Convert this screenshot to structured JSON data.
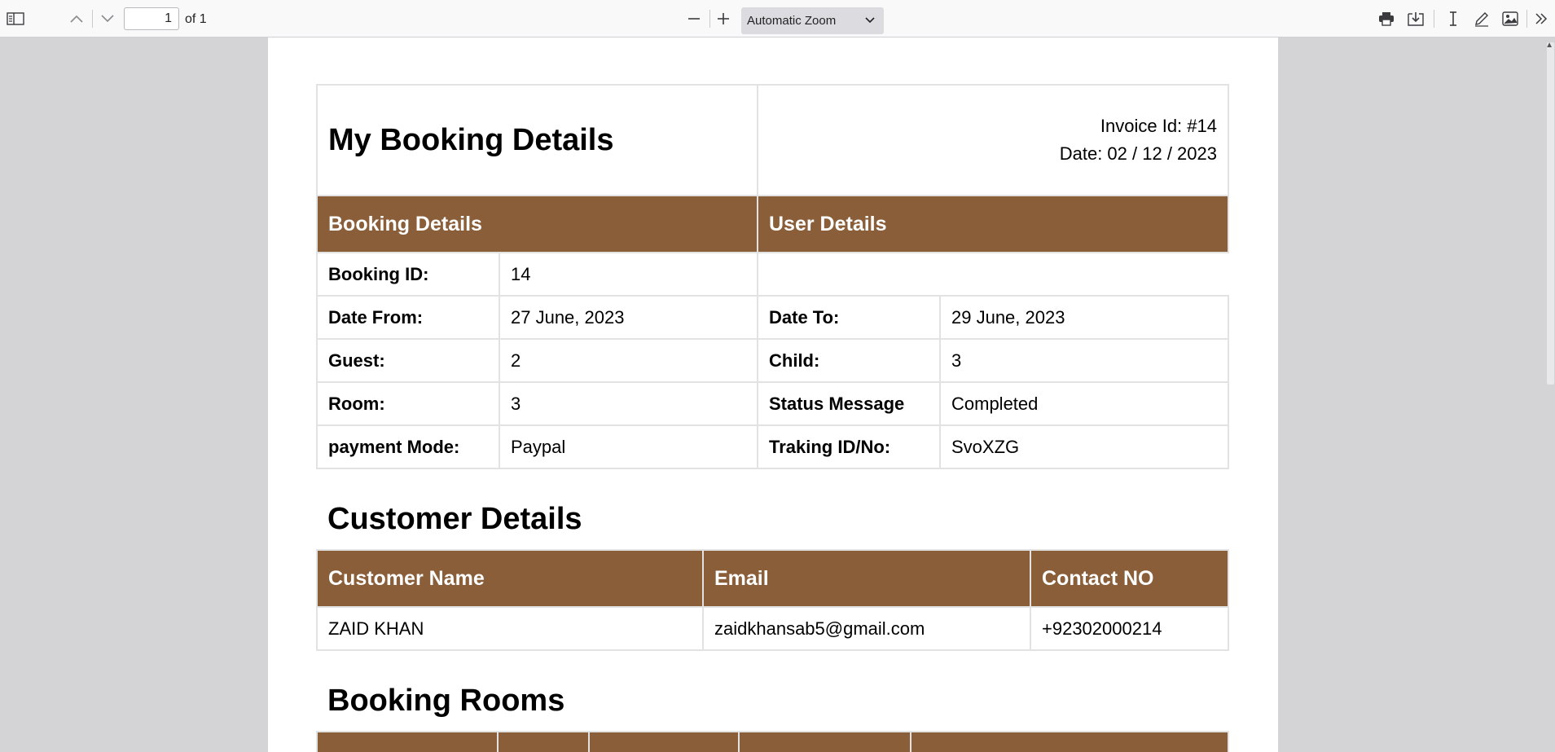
{
  "toolbar": {
    "page_number": "1",
    "page_count_label": "of 1",
    "zoom_label": "Automatic Zoom"
  },
  "doc": {
    "title": "My Booking Details",
    "invoice_id": "Invoice Id: #14",
    "invoice_date": "Date: 02 / 12 / 2023",
    "booking_header": "Booking Details",
    "user_header": "User Details",
    "booking_rows": [
      {
        "l1": "Booking ID:",
        "v1": "14",
        "l2": "",
        "v2": ""
      },
      {
        "l1": "Date From:",
        "v1": "27 June, 2023",
        "l2": "Date To:",
        "v2": "29 June, 2023"
      },
      {
        "l1": "Guest:",
        "v1": "2",
        "l2": "Child:",
        "v2": "3"
      },
      {
        "l1": "Room:",
        "v1": "3",
        "l2": "Status Message",
        "v2": "Completed"
      },
      {
        "l1": "payment Mode:",
        "v1": "Paypal",
        "l2": "Traking ID/No:",
        "v2": "SvoXZG"
      }
    ],
    "customer_heading": "Customer Details",
    "customer_columns": [
      "Customer Name",
      "Email",
      "Contact NO"
    ],
    "customer_row": [
      "ZAID KHAN",
      "zaidkhansab5@gmail.com",
      "+92302000214"
    ],
    "rooms_heading": "Booking Rooms"
  }
}
